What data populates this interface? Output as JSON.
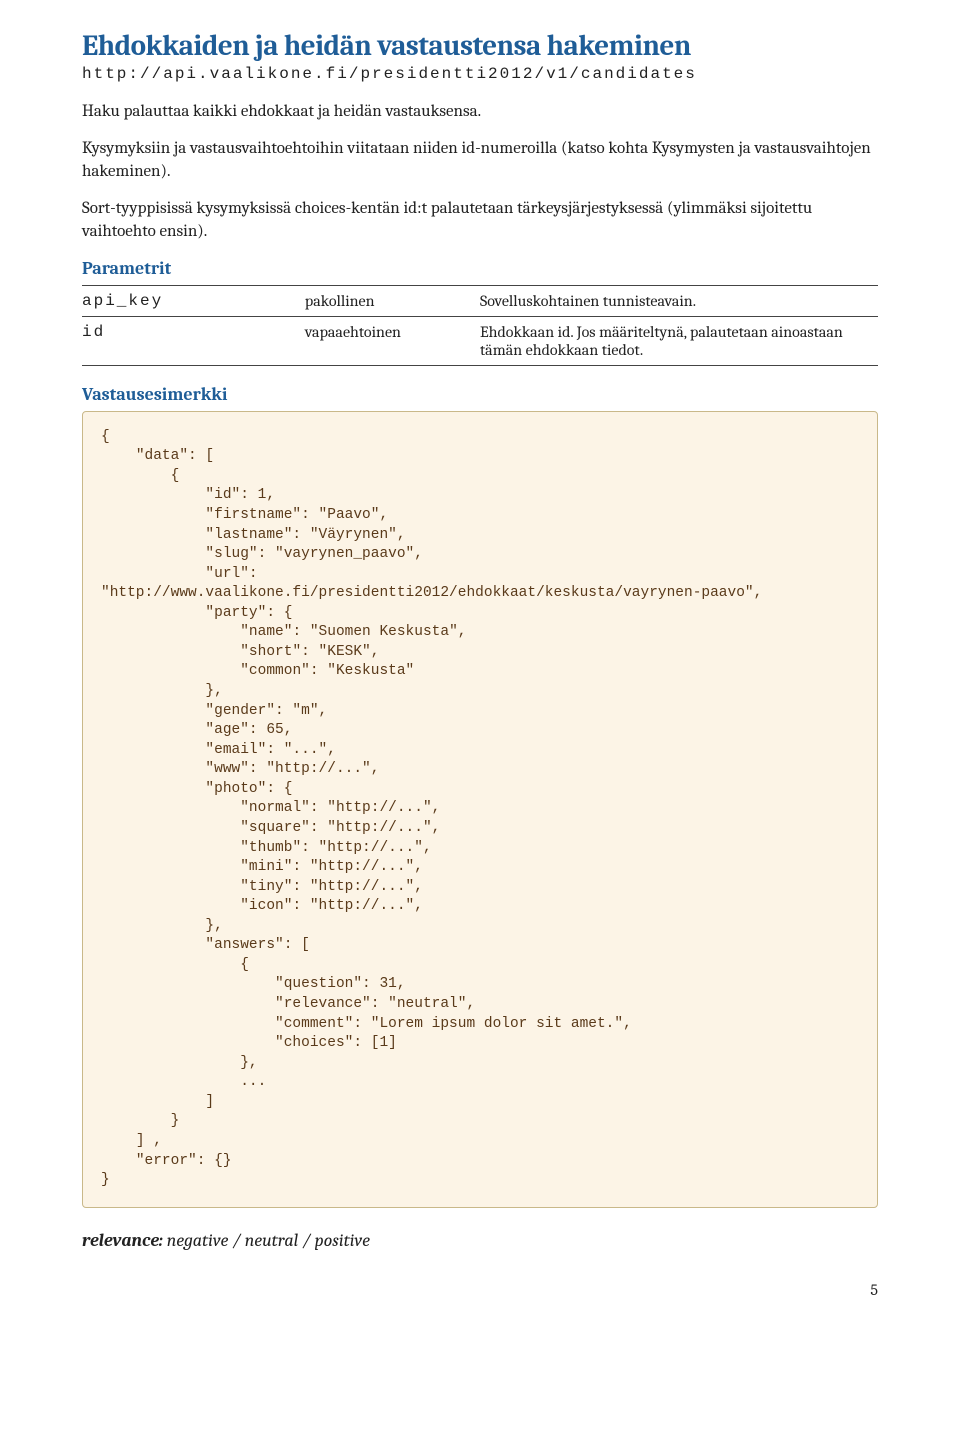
{
  "title": "Ehdokkaiden ja heidän vastaustensa hakeminen",
  "endpoint": "http://api.vaalikone.fi/presidentti2012/v1/candidates",
  "paragraphs": {
    "p1": "Haku palauttaa kaikki ehdokkaat ja heidän vastauksensa.",
    "p2": "Kysymyksiin ja vastausvaihtoehtoihin viitataan niiden id-numeroilla (katso kohta Kysymysten ja vastausvaihtojen hakeminen).",
    "p3": "Sort-tyyppisissä kysymyksissä choices-kentän id:t palautetaan tärkeysjärjestyksessä (ylimmäksi sijoitettu vaihtoehto ensin)."
  },
  "sections": {
    "parametrit": "Parametrit",
    "vastaus": "Vastausesimerkki"
  },
  "params": [
    {
      "name": "api_key",
      "req": "pakollinen",
      "desc": "Sovelluskohtainen tunnisteavain."
    },
    {
      "name": "id",
      "req": "vapaaehtoinen",
      "desc": "Ehdokkaan id. Jos määriteltynä, palautetaan ainoastaan tämän ehdokkaan tiedot."
    }
  ],
  "code": "{\n    \"data\": [\n        {\n            \"id\": 1,\n            \"firstname\": \"Paavo\",\n            \"lastname\": \"Väyrynen\",\n            \"slug\": \"vayrynen_paavo\",\n            \"url\":\n\"http://www.vaalikone.fi/presidentti2012/ehdokkaat/keskusta/vayrynen-paavo\",\n            \"party\": {\n                \"name\": \"Suomen Keskusta\",\n                \"short\": \"KESK\",\n                \"common\": \"Keskusta\"\n            },\n            \"gender\": \"m\",\n            \"age\": 65,\n            \"email\": \"...\",\n            \"www\": \"http://...\",\n            \"photo\": {\n                \"normal\": \"http://...\",\n                \"square\": \"http://...\",\n                \"thumb\": \"http://...\",\n                \"mini\": \"http://...\",\n                \"tiny\": \"http://...\",\n                \"icon\": \"http://...\",\n            },\n            \"answers\": [\n                {\n                    \"question\": 31,\n                    \"relevance\": \"neutral\",\n                    \"comment\": \"Lorem ipsum dolor sit amet.\",\n                    \"choices\": [1]\n                },\n                ...\n            ]\n        }\n    ] ,\n    \"error\": {}\n}",
  "footnote": {
    "label": "relevance:",
    "values": " negative / neutral / positive"
  },
  "pagenum": "5"
}
